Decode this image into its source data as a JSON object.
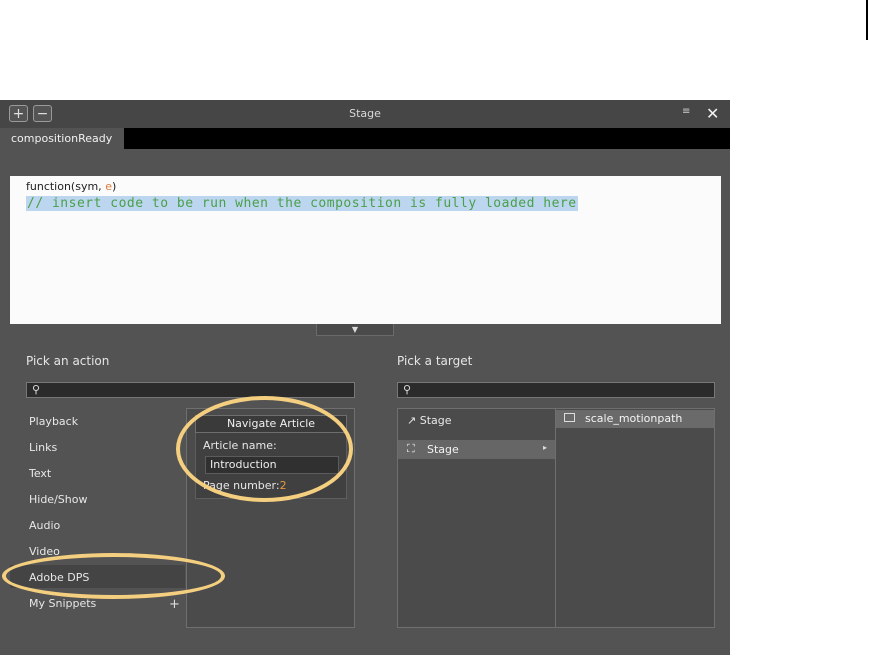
{
  "window": {
    "title": "Stage",
    "add_label": "+",
    "remove_label": "−",
    "menu_icon": "≡",
    "close_icon": "✕"
  },
  "tab": {
    "label": "compositionReady"
  },
  "code": {
    "line1_prefix": "function(sym, ",
    "line1_param": "e",
    "line1_suffix": ")",
    "line2": "// insert code to be run when the composition is fully loaded here"
  },
  "expander": {
    "icon": "▼"
  },
  "actions": {
    "heading": "Pick an action",
    "search_placeholder": "",
    "categories": [
      "Playback",
      "Links",
      "Text",
      "Hide/Show",
      "Audio",
      "Video",
      "Adobe DPS",
      "My Snippets"
    ],
    "selected_category": "Adobe DPS",
    "add_snippet_icon": "+",
    "panel": {
      "header": "Navigate Article",
      "article_label": "Article name:",
      "article_value": "Introduction",
      "page_label": "Page number:",
      "page_value": "2"
    }
  },
  "targets": {
    "heading": "Pick a target",
    "search_placeholder": "",
    "up_item": "Stage",
    "selected_item": "Stage",
    "child_item": "scale_motionpath"
  },
  "colors": {
    "panel_bg": "#535353",
    "highlight_ring": "#f5cf80",
    "code_comment": "#4aa04a",
    "code_selection": "#bcd6ef"
  }
}
